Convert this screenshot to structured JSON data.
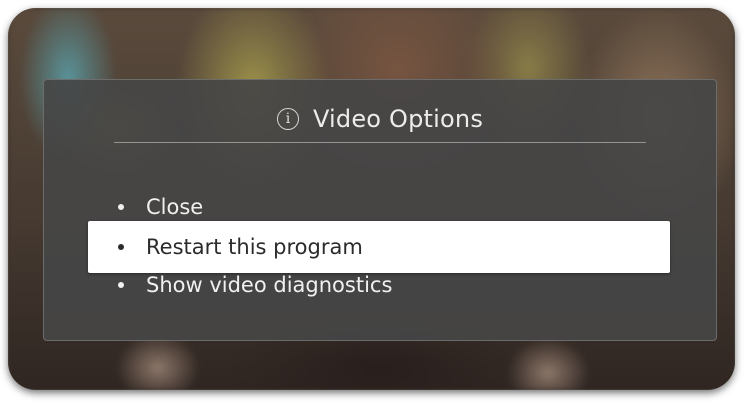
{
  "dialog": {
    "icon": "info-icon",
    "icon_glyph": "i",
    "title": "Video Options"
  },
  "options": [
    {
      "label": "Close",
      "selected": false
    },
    {
      "label": "Restart this program",
      "selected": true
    },
    {
      "label": "Show video diagnostics",
      "selected": false
    }
  ],
  "colors": {
    "dialog_bg": "#464646",
    "selected_bg": "#ffffff",
    "text": "#f0f0f0",
    "selected_text": "#2b2b2b"
  }
}
